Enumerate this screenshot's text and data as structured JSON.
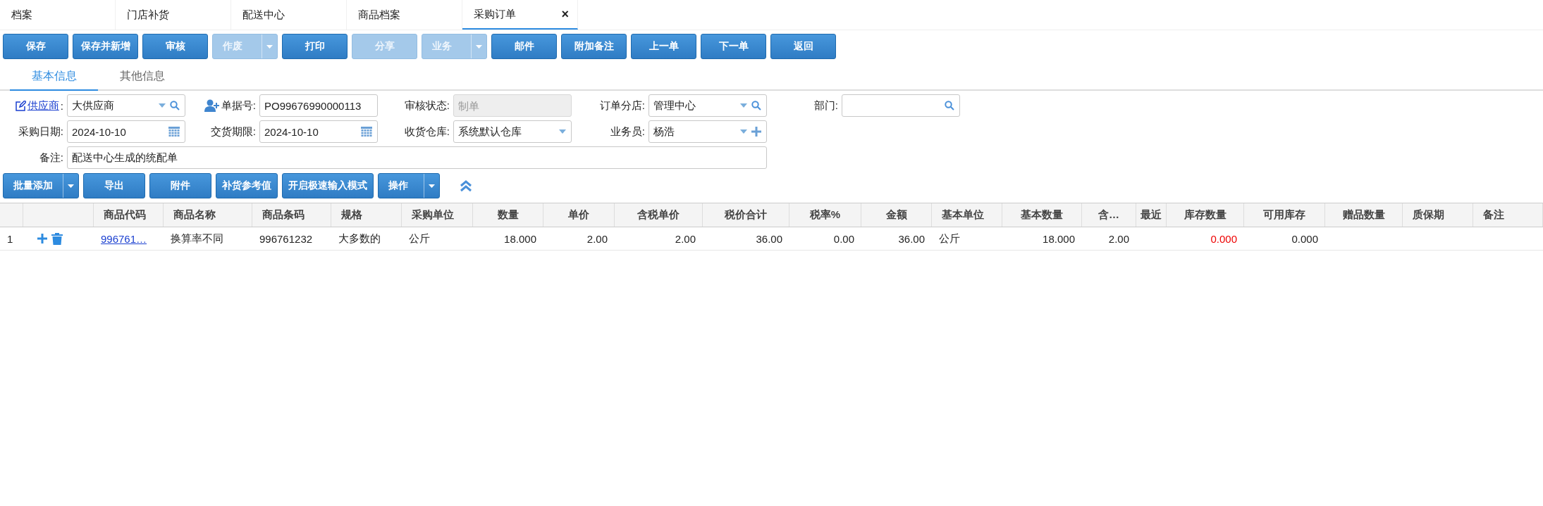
{
  "tabs": [
    {
      "label": "档案",
      "selected": false,
      "closable": false
    },
    {
      "label": "门店补货",
      "selected": false,
      "closable": false
    },
    {
      "label": "配送中心",
      "selected": false,
      "closable": false
    },
    {
      "label": "商品档案",
      "selected": false,
      "closable": false
    },
    {
      "label": "采购订单",
      "selected": true,
      "closable": true
    }
  ],
  "close_glyph": "×",
  "toolbar": [
    {
      "label": "保存",
      "disabled": false,
      "dropdown": false
    },
    {
      "label": "保存并新增",
      "disabled": false,
      "dropdown": false
    },
    {
      "label": "审核",
      "disabled": false,
      "dropdown": false
    },
    {
      "label": "作废",
      "disabled": true,
      "dropdown": true
    },
    {
      "label": "打印",
      "disabled": false,
      "dropdown": false
    },
    {
      "label": "分享",
      "disabled": true,
      "dropdown": false
    },
    {
      "label": "业务",
      "disabled": true,
      "dropdown": true
    },
    {
      "label": "邮件",
      "disabled": false,
      "dropdown": false
    },
    {
      "label": "附加备注",
      "disabled": false,
      "dropdown": false
    },
    {
      "label": "上一单",
      "disabled": false,
      "dropdown": false
    },
    {
      "label": "下一单",
      "disabled": false,
      "dropdown": false
    },
    {
      "label": "返回",
      "disabled": false,
      "dropdown": false
    }
  ],
  "sub_tabs": [
    {
      "label": "基本信息",
      "selected": true
    },
    {
      "label": "其他信息",
      "selected": false
    }
  ],
  "form_rows": [
    [
      {
        "label": "供应商",
        "label_suffix": ":",
        "label_link": true,
        "label_icon": false,
        "kind": "select-search",
        "value": "大供应商",
        "disabled": false
      },
      {
        "label": "单据号:",
        "label_link": false,
        "label_icon": true,
        "kind": "text",
        "value": "PO99676990000113",
        "disabled": false
      },
      {
        "label": "审核状态:",
        "label_link": false,
        "label_icon": false,
        "kind": "text",
        "placeholder": "制单",
        "disabled": true
      },
      {
        "label": "订单分店:",
        "label_link": false,
        "label_icon": false,
        "kind": "select-search",
        "value": "管理中心",
        "disabled": false
      },
      {
        "label": "部门:",
        "label_link": false,
        "label_icon": false,
        "kind": "search",
        "disabled": false
      }
    ],
    [
      {
        "label": "采购日期:",
        "label_link": false,
        "label_icon": false,
        "kind": "date",
        "value": "2024-10-10",
        "disabled": false
      },
      {
        "label": "交货期限:",
        "label_link": false,
        "label_icon": false,
        "kind": "date",
        "value": "2024-10-10",
        "disabled": false
      },
      {
        "label": "收货仓库:",
        "label_link": false,
        "label_icon": false,
        "kind": "select",
        "value": "系统默认仓库",
        "disabled": false
      },
      {
        "label": "业务员:",
        "label_link": false,
        "label_icon": false,
        "kind": "select-add",
        "value": "杨浩",
        "disabled": false
      }
    ],
    [
      {
        "label": "备注:",
        "label_link": false,
        "label_icon": false,
        "kind": "text",
        "value": "配送中心生成的统配单",
        "disabled": false
      }
    ]
  ],
  "actions": [
    {
      "label": "批量添加",
      "dropdown": true
    },
    {
      "label": "导出",
      "dropdown": false
    },
    {
      "label": "附件",
      "dropdown": false
    },
    {
      "label": "补货参考值",
      "dropdown": false
    },
    {
      "label": "开启极速输入模式",
      "dropdown": false
    },
    {
      "label": "操作",
      "dropdown": true
    }
  ],
  "table": {
    "columns": [
      {
        "label": "商品代码",
        "kind": "link"
      },
      {
        "label": "商品名称",
        "kind": "text"
      },
      {
        "label": "商品条码",
        "kind": "text"
      },
      {
        "label": "规格",
        "kind": "text"
      },
      {
        "label": "采购单位",
        "kind": "text"
      },
      {
        "label": "数量",
        "kind": "number"
      },
      {
        "label": "单价",
        "kind": "number"
      },
      {
        "label": "含税单价",
        "kind": "number"
      },
      {
        "label": "税价合计",
        "kind": "number"
      },
      {
        "label": "税率%",
        "kind": "number"
      },
      {
        "label": "金额",
        "kind": "number"
      },
      {
        "label": "基本单位",
        "kind": "text"
      },
      {
        "label": "基本数量",
        "kind": "number"
      },
      {
        "label": "含…",
        "kind": "number"
      },
      {
        "label": "最近",
        "kind": "number"
      },
      {
        "label": "库存数量",
        "kind": "number"
      },
      {
        "label": "可用库存",
        "kind": "number"
      },
      {
        "label": "赠品数量",
        "kind": "number"
      },
      {
        "label": "质保期",
        "kind": "text"
      },
      {
        "label": "备注",
        "kind": "text"
      }
    ],
    "rows": [
      {
        "index": "1",
        "cells": [
          {
            "text": "996761…",
            "alert": false
          },
          {
            "text": "换算率不同",
            "alert": false
          },
          {
            "text": "996761232",
            "alert": false
          },
          {
            "text": "大多数的",
            "alert": false
          },
          {
            "text": "公斤",
            "alert": false
          },
          {
            "text": "18.000",
            "alert": false
          },
          {
            "text": "2.00",
            "alert": false
          },
          {
            "text": "2.00",
            "alert": false
          },
          {
            "text": "36.00",
            "alert": false
          },
          {
            "text": "0.00",
            "alert": false
          },
          {
            "text": "36.00",
            "alert": false
          },
          {
            "text": "公斤",
            "alert": false
          },
          {
            "text": "18.000",
            "alert": false
          },
          {
            "text": "2.00",
            "alert": false
          },
          null,
          {
            "text": "0.000",
            "alert": true
          },
          {
            "text": "0.000",
            "alert": false
          }
        ]
      }
    ]
  }
}
